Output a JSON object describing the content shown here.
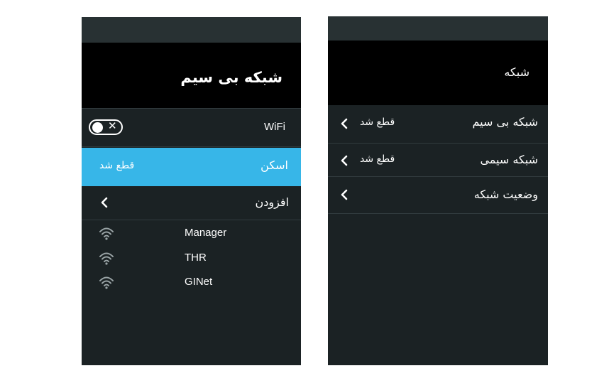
{
  "left_screen": {
    "title": "شبکه بی سیم",
    "wifi": {
      "label": "WiFi",
      "enabled": false,
      "toggle_symbol": "✕"
    },
    "scan": {
      "label": "اسکن",
      "status": "قطع شد"
    },
    "add": {
      "label": "افزودن"
    },
    "networks": [
      {
        "name": "Manager",
        "icon": "wifi-icon"
      },
      {
        "name": "THR",
        "icon": "wifi-icon"
      },
      {
        "name": "GINet",
        "icon": "wifi-icon"
      }
    ]
  },
  "right_screen": {
    "title": "شبکه",
    "items": [
      {
        "label": "شبکه بی سیم",
        "status": "قطع شد"
      },
      {
        "label": "شبکه سیمی",
        "status": "قطع شد"
      },
      {
        "label": "وضعیت شبکه",
        "status": ""
      }
    ]
  },
  "colors": {
    "panel_bg": "#1b2224",
    "status_bar": "#283133",
    "title_bar": "#000000",
    "highlight": "#37b6e8",
    "text": "#ffffff",
    "wifi_icon": "#9aa4a6"
  }
}
